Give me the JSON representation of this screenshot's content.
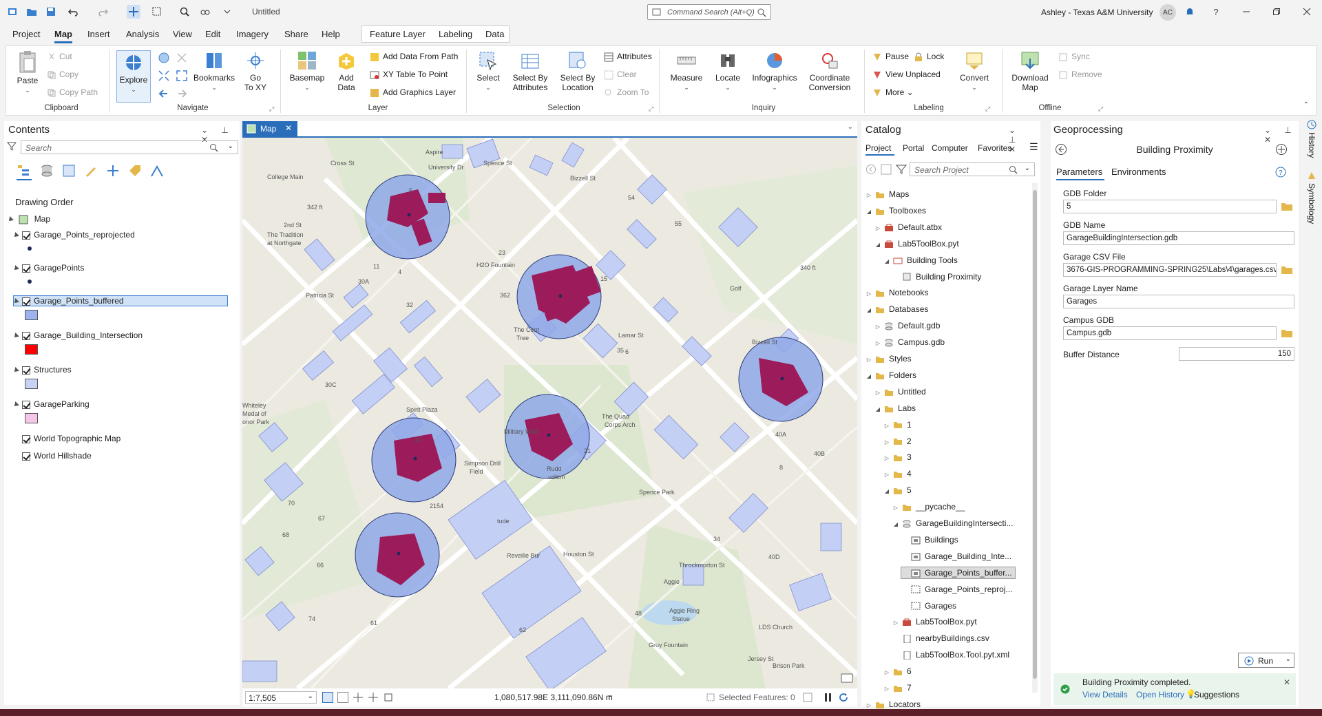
{
  "window": {
    "doc_title": "Untitled",
    "command_search_placeholder": "Command Search (Alt+Q)",
    "user": "Ashley - Texas A&M University",
    "avatar_initials": "AC"
  },
  "menu": {
    "tabs": [
      "Project",
      "Map",
      "Insert",
      "Analysis",
      "View",
      "Edit",
      "Imagery",
      "Share",
      "Help"
    ],
    "context_tabs": [
      "Feature Layer",
      "Labeling",
      "Data"
    ],
    "active": "Map"
  },
  "ribbon": {
    "clipboard": {
      "label": "Clipboard",
      "paste": "Paste",
      "cut": "Cut",
      "copy": "Copy",
      "copy_path": "Copy Path"
    },
    "navigate": {
      "label": "Navigate",
      "explore": "Explore",
      "bookmarks": "Bookmarks",
      "go_to_xy_1": "Go",
      "go_to_xy_2": "To XY"
    },
    "layer": {
      "label": "Layer",
      "basemap": "Basemap",
      "add_data_1": "Add",
      "add_data_2": "Data",
      "add_data_from_path": "Add Data From Path",
      "xy_table_to_point": "XY Table To Point",
      "add_graphics_layer": "Add Graphics Layer"
    },
    "selection": {
      "label": "Selection",
      "select": "Select",
      "select_by_attr_1": "Select By",
      "select_by_attr_2": "Attributes",
      "select_by_loc_1": "Select By",
      "select_by_loc_2": "Location",
      "attributes": "Attributes",
      "clear": "Clear",
      "zoom_to": "Zoom To"
    },
    "inquiry": {
      "label": "Inquiry",
      "measure": "Measure",
      "locate": "Locate",
      "infographics": "Infographics",
      "coord_1": "Coordinate",
      "coord_2": "Conversion"
    },
    "labeling": {
      "label": "Labeling",
      "pause": "Pause",
      "lock": "Lock",
      "view_unplaced": "View Unplaced",
      "more": "More",
      "convert": "Convert"
    },
    "offline": {
      "label": "Offline",
      "download_1": "Download",
      "download_2": "Map",
      "sync": "Sync",
      "remove": "Remove"
    }
  },
  "contents": {
    "title": "Contents",
    "search_placeholder": "Search",
    "drawing_order": "Drawing Order",
    "map_label": "Map",
    "layers": [
      {
        "name": "Garage_Points_reprojected",
        "swatch": "point",
        "color": "#1f2a5a"
      },
      {
        "name": "GaragePoints",
        "swatch": "point",
        "color": "#1f2a5a"
      },
      {
        "name": "Garage_Points_buffered",
        "swatch": "fill",
        "color": "#9db3ef",
        "selected": true
      },
      {
        "name": "Garage_Building_Intersection",
        "swatch": "fill",
        "color": "#ff0000"
      },
      {
        "name": "Structures",
        "swatch": "fill",
        "color": "#c8d2f5"
      },
      {
        "name": "GarageParking",
        "swatch": "fill",
        "color": "#f6c6e8"
      },
      {
        "name": "World Topographic Map",
        "swatch": null
      },
      {
        "name": "World Hillshade",
        "swatch": null
      }
    ]
  },
  "map": {
    "tab_label": "Map",
    "scale": "1:7,505",
    "coords": "1,080,517.98E 3,111,090.86N m",
    "selected_features": "Selected Features: 0",
    "labels": [
      "Aspire",
      "College Main",
      "Cross St",
      "University Dr",
      "Spence St",
      "Bizzell St",
      "54",
      "55",
      "5",
      "342 ft",
      "2nd St",
      "The Tradition",
      "at Northgate",
      "11",
      "4",
      "H2O Fountain",
      "23",
      "340 ft",
      "Golf",
      "15",
      "30A",
      "Patricia St",
      "32",
      "362",
      "35",
      "The Cent",
      "Tree",
      "6",
      "Lamar St",
      "Bizzell St",
      "30C",
      "Spirit Plaza",
      "The Quad",
      "Corps Arch",
      "Whiteley",
      "Medal of",
      "onor Park",
      "20",
      "Military Walk",
      "21",
      "Simpson Drill",
      "Field",
      "Rudd",
      "uditori",
      "70",
      "40A",
      "40B",
      "2154",
      "Spence Park",
      "8",
      "67",
      "tude",
      "Houston St",
      "Throckmorton St",
      "34",
      "68",
      "Reveille Bur",
      "40D",
      "66",
      "Aggie",
      "61",
      "62",
      "48",
      "74",
      "Aggie Ring",
      "Statue",
      "LDS Church",
      "Gruy Fountain",
      "Brison Park",
      "Jersey St"
    ]
  },
  "catalog": {
    "title": "Catalog",
    "tabs": [
      "Project",
      "Portal",
      "Computer",
      "Favorites"
    ],
    "search_placeholder": "Search Project",
    "tree": [
      {
        "label": "Maps",
        "indent": 0,
        "exp": "closed",
        "icon": "folder"
      },
      {
        "label": "Toolboxes",
        "indent": 0,
        "exp": "open",
        "icon": "folder"
      },
      {
        "label": "Default.atbx",
        "indent": 1,
        "exp": "closed",
        "icon": "toolbox"
      },
      {
        "label": "Lab5ToolBox.pyt",
        "indent": 1,
        "exp": "open",
        "icon": "toolbox"
      },
      {
        "label": "Building Tools",
        "indent": 2,
        "exp": "open",
        "icon": "toolset"
      },
      {
        "label": "Building Proximity",
        "indent": 3,
        "exp": "none",
        "icon": "script"
      },
      {
        "label": "Notebooks",
        "indent": 0,
        "exp": "closed",
        "icon": "folder"
      },
      {
        "label": "Databases",
        "indent": 0,
        "exp": "open",
        "icon": "folder"
      },
      {
        "label": "Default.gdb",
        "indent": 1,
        "exp": "closed",
        "icon": "gdb"
      },
      {
        "label": "Campus.gdb",
        "indent": 1,
        "exp": "closed",
        "icon": "gdb"
      },
      {
        "label": "Styles",
        "indent": 0,
        "exp": "closed",
        "icon": "folder"
      },
      {
        "label": "Folders",
        "indent": 0,
        "exp": "open",
        "icon": "folder"
      },
      {
        "label": "Untitled",
        "indent": 1,
        "exp": "closed",
        "icon": "folder"
      },
      {
        "label": "Labs",
        "indent": 1,
        "exp": "open",
        "icon": "folder"
      },
      {
        "label": "1",
        "indent": 2,
        "exp": "closed",
        "icon": "folder"
      },
      {
        "label": "2",
        "indent": 2,
        "exp": "closed",
        "icon": "folder"
      },
      {
        "label": "3",
        "indent": 2,
        "exp": "closed",
        "icon": "folder"
      },
      {
        "label": "4",
        "indent": 2,
        "exp": "closed",
        "icon": "folder"
      },
      {
        "label": "5",
        "indent": 2,
        "exp": "open",
        "icon": "folder"
      },
      {
        "label": "__pycache__",
        "indent": 3,
        "exp": "closed",
        "icon": "folder"
      },
      {
        "label": "GarageBuildingIntersecti...",
        "indent": 3,
        "exp": "open",
        "icon": "gdb"
      },
      {
        "label": "Buildings",
        "indent": 4,
        "exp": "none",
        "icon": "fc"
      },
      {
        "label": "Garage_Building_Inte...",
        "indent": 4,
        "exp": "none",
        "icon": "fc"
      },
      {
        "label": "Garage_Points_buffer...",
        "indent": 4,
        "exp": "none",
        "icon": "fc",
        "selected": true
      },
      {
        "label": "Garage_Points_reproj...",
        "indent": 4,
        "exp": "none",
        "icon": "fcpt"
      },
      {
        "label": "Garages",
        "indent": 4,
        "exp": "none",
        "icon": "fcpt"
      },
      {
        "label": "Lab5ToolBox.pyt",
        "indent": 3,
        "exp": "closed",
        "icon": "toolbox"
      },
      {
        "label": "nearbyBuildings.csv",
        "indent": 3,
        "exp": "none",
        "icon": "file"
      },
      {
        "label": "Lab5ToolBox.Tool.pyt.xml",
        "indent": 3,
        "exp": "none",
        "icon": "file"
      },
      {
        "label": "6",
        "indent": 2,
        "exp": "closed",
        "icon": "folder"
      },
      {
        "label": "7",
        "indent": 2,
        "exp": "closed",
        "icon": "folder"
      },
      {
        "label": "Locators",
        "indent": 0,
        "exp": "closed",
        "icon": "folder"
      }
    ]
  },
  "geoprocessing": {
    "title": "Geoprocessing",
    "tool_name": "Building Proximity",
    "tabs": [
      "Parameters",
      "Environments"
    ],
    "params": [
      {
        "label": "GDB Folder",
        "value": "5"
      },
      {
        "label": "GDB Name",
        "value": "GarageBuildingIntersection.gdb"
      },
      {
        "label": "Garage CSV File",
        "value": "3676-GIS-PROGRAMMING-SPRING25\\Labs\\4\\garages.csv"
      },
      {
        "label": "Garage Layer Name",
        "value": "Garages"
      },
      {
        "label": "Campus GDB",
        "value": "Campus.gdb"
      },
      {
        "label": "Buffer Distance",
        "value": "150"
      }
    ],
    "run": "Run",
    "completion_message": "Building Proximity completed.",
    "view_details": "View Details",
    "open_history": "Open History",
    "suggestions": "Suggestions"
  },
  "side_tabs": [
    "History",
    "Symbology"
  ],
  "colors": {
    "accent": "#2a6ebb",
    "buffer_fill": "#8fa8e8",
    "intersection": "#9c1b5a",
    "structure": "#c4cff5",
    "success": "#2e9e47"
  }
}
